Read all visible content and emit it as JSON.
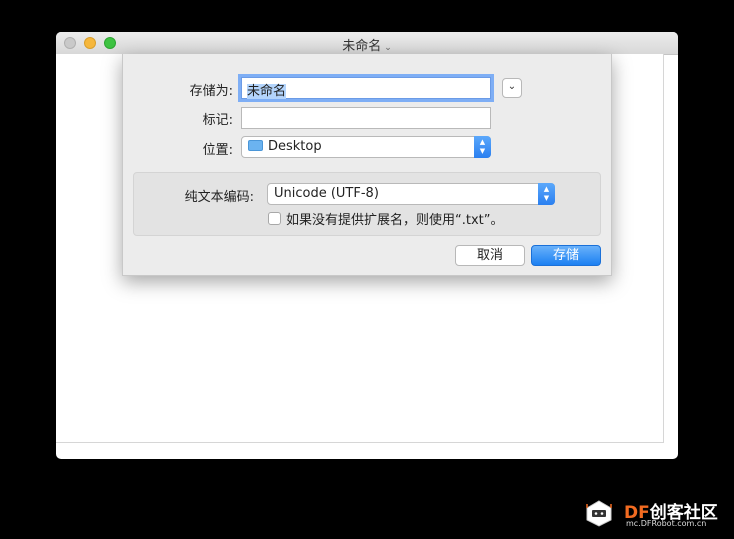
{
  "window": {
    "title": "未命名",
    "title_chevron": "⌄"
  },
  "dialog": {
    "save_as_label": "存储为:",
    "save_as_value": "未命名",
    "tags_label": "标记:",
    "tags_value": "",
    "location_label": "位置:",
    "location_value": "Desktop",
    "expand_chevron": "⌄",
    "encoding_label": "纯文本编码:",
    "encoding_value": "Unicode (UTF-8)",
    "extension_checkbox_label": "如果没有提供扩展名，则使用“.txt”。",
    "extension_checked": false,
    "cancel_label": "取消",
    "save_label": "存储"
  },
  "watermark": {
    "brand_prefix": "DF",
    "brand_rest": "创客社区",
    "url": "mc.DFRobot.com.cn"
  },
  "colors": {
    "accent": "#2a7ff0",
    "focus_ring": "#7eaef5",
    "brand_orange": "#f26b21"
  }
}
